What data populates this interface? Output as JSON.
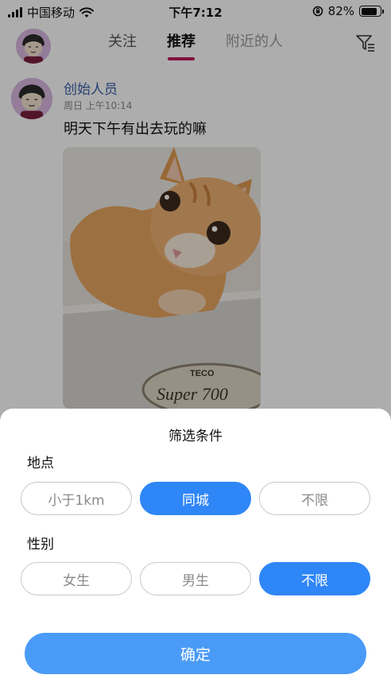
{
  "status_bar": {
    "carrier": "中国移动",
    "time": "下午7:12",
    "battery_percent": "82%",
    "battery_level": 0.82
  },
  "nav": {
    "tabs": [
      {
        "label": "关注"
      },
      {
        "label": "推荐"
      },
      {
        "label": "附近的人"
      }
    ],
    "active_tab": "推荐",
    "accent_color": "#c2185b"
  },
  "post": {
    "author": "创始人员",
    "timestamp": "周日 上午10:14",
    "content": "明天下午有出去玩的嘛",
    "photo_brand_small": "TECO",
    "photo_brand_large": "Super 700"
  },
  "filter_sheet": {
    "title": "筛选条件",
    "location": {
      "label": "地点",
      "options": [
        "小于1km",
        "同城",
        "不限"
      ],
      "selected": "同城"
    },
    "gender": {
      "label": "性别",
      "options": [
        "女生",
        "男生",
        "不限"
      ],
      "selected": "不限"
    },
    "confirm_label": "确定",
    "accent_color": "#2f86f6"
  }
}
